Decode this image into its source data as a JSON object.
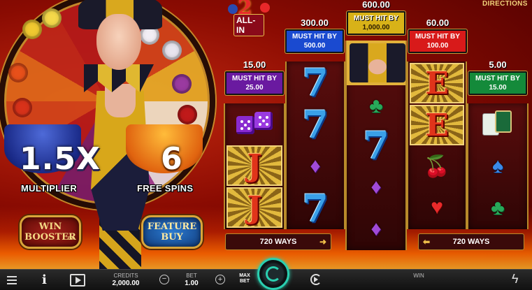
{
  "logo": {
    "number": "2",
    "text": "ALL-IN"
  },
  "directions_label": "DIRECTIONS",
  "features": {
    "multiplier_value": "1.5X",
    "multiplier_label": "MULTIPLIER",
    "free_spins_value": "6",
    "free_spins_label": "FREE SPINS",
    "win_booster_line1": "WIN",
    "win_booster_line2": "BOOSTER",
    "win_booster_tm": "TM",
    "feature_buy_line1": "FEATURE",
    "feature_buy_line2": "BUY"
  },
  "jackpots": [
    {
      "amount": "15.00",
      "label": "MUST HIT BY",
      "target": "25.00",
      "color": "#6a1aa0"
    },
    {
      "amount": "300.00",
      "label": "MUST HIT BY",
      "target": "500.00",
      "color": "#1a4ad0"
    },
    {
      "amount": "600.00",
      "label": "MUST HIT BY",
      "target": "1,000.00",
      "color": "#d8b218"
    },
    {
      "amount": "60.00",
      "label": "MUST HIT BY",
      "target": "100.00",
      "color": "#d81a1a"
    },
    {
      "amount": "5.00",
      "label": "MUST HIT BY",
      "target": "15.00",
      "color": "#148a3a"
    }
  ],
  "ways": {
    "left": "720 WAYS",
    "right": "720 WAYS"
  },
  "bottom_bar": {
    "credits_label": "CREDITS",
    "credits_value": "2,000.00",
    "bet_label": "BET",
    "bet_value": "1.00",
    "max_bet_line1": "MAX",
    "max_bet_line2": "BET",
    "win_label": "WIN",
    "minus": "−",
    "plus": "+"
  },
  "colors": {
    "accent_gold": "#d9a53a",
    "spin_teal": "#2acfb0",
    "background_red": "#8a0b02"
  },
  "icons": {
    "menu": "hamburger-menu-icon",
    "info": "info-icon",
    "video": "video-icon",
    "autoplay": "autoplay-icon",
    "turbo": "lightning-icon",
    "spin": "spin-icon"
  }
}
